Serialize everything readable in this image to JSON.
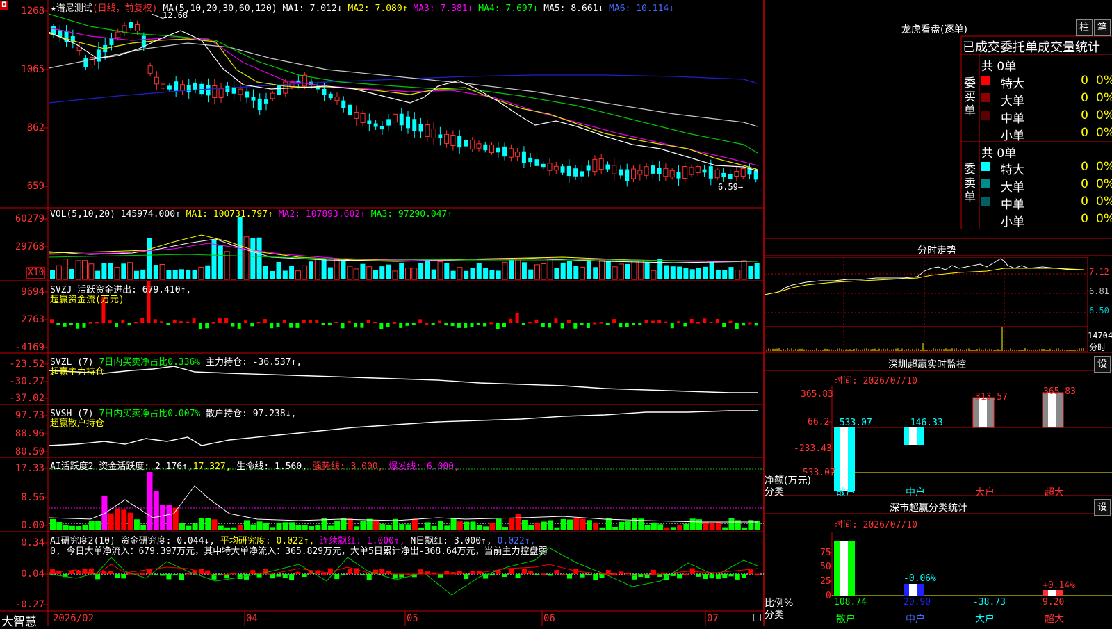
{
  "main_chart": {
    "logo": "◘",
    "stock_name": "★谱尼测试",
    "period": "(日线，前复权)",
    "ma_label": "MA(5,10,20,30,60,120)",
    "ma1": "MA1: 7.012↓",
    "ma2": "MA2: 7.080↑",
    "ma3": "MA3: 7.381↓",
    "ma4": "MA4: 7.697↓",
    "ma5": "MA5: 8.661↓",
    "ma6": "MA6: 10.114↓",
    "high_marker": "12.68",
    "low_marker": "6.59→",
    "axis": [
      "1268",
      "1065",
      "862",
      "659"
    ]
  },
  "vol_pane": {
    "label": "VOL(5,10,20)",
    "value": "145974.000↑",
    "ma1": "MA1: 100731.797↑",
    "ma2": "MA2: 107893.602↑",
    "ma3": "MA3: 97290.047↑",
    "axis": [
      "60279",
      "29768"
    ],
    "unit": "X10"
  },
  "svzj_pane": {
    "label": "SVZJ",
    "text": "活跃资金进出: 679.410↑,",
    "subtitle": "超赢资金流(万元)",
    "axis": [
      "9694",
      "2763",
      "-4169"
    ]
  },
  "svzl_pane": {
    "label": "SVZL (7)",
    "text_green": "7日内买卖净占比0.336%",
    "text_white": "主力持仓: -36.537↑,",
    "subtitle": "超赢主力持仓",
    "axis": [
      "-23.52",
      "-30.27",
      "-37.02"
    ]
  },
  "svsh_pane": {
    "label": "SVSH (7)",
    "text_green": "7日内买卖净占比0.007%",
    "text_white": "散户持仓: 97.238↓,",
    "subtitle": "超赢散户持仓",
    "axis": [
      "97.73",
      "88.96",
      "80.50"
    ]
  },
  "ai_act_pane": {
    "label": "AI活跃度2",
    "t1": "资金活跃度: 2.176↑,",
    "t2": "17.327,",
    "t3": "生命线: 1.560,",
    "t4": "强势线: 3.000,",
    "t5": "爆发线: 6.000,",
    "axis": [
      "17.33",
      "8.56",
      "0.00"
    ]
  },
  "ai_res_pane": {
    "label": "AI研究度2(10)",
    "t1": "资金研究度: 0.044↓,",
    "t2": "平均研究度: 0.022↑,",
    "t3": "连续飘红: 1.000↑,",
    "t4": "N日飘红: 3.000↑,",
    "t5": "0.022↑,",
    "desc": "0, 今日大单净流入：679.397万元，其中特大单净流入：365.829万元，大单5日累计净出-368.64万元，当前主力控盘弱",
    "axis": [
      "0.34",
      "0.04",
      "-0.27"
    ]
  },
  "footer": {
    "brand": "大智慧",
    "dates": [
      "2026/02",
      "04",
      "05",
      "06",
      "07"
    ]
  },
  "right_panel": {
    "dragon_title": "龙虎看盘(逐单)",
    "btn_bar": "柱",
    "btn_pen": "笔",
    "tab_title": "已成交委托单成交量统计",
    "buy_side": "委买单",
    "sell_side": "委卖单",
    "buy_total": "共 0单",
    "sell_total": "共 0单",
    "buy_rows": [
      {
        "name": "特大",
        "v1": "0",
        "v2": "0%",
        "color": "#ff0000"
      },
      {
        "name": "大单",
        "v1": "0",
        "v2": "0%",
        "color": "#8b0000"
      },
      {
        "name": "中单",
        "v1": "0",
        "v2": "0%",
        "color": "#5a0000"
      },
      {
        "name": "小单",
        "v1": "0",
        "v2": "0%",
        "color": "#000000"
      }
    ],
    "sell_rows": [
      {
        "name": "特大",
        "v1": "0",
        "v2": "0%",
        "color": "#00ffff"
      },
      {
        "name": "大单",
        "v1": "0",
        "v2": "0%",
        "color": "#008b8b"
      },
      {
        "name": "中单",
        "v1": "0",
        "v2": "0%",
        "color": "#006060"
      },
      {
        "name": "小单",
        "v1": "0",
        "v2": "0%",
        "color": "#000000"
      }
    ],
    "intraday_title": "分时走势",
    "intraday_axis": [
      "7.12",
      "6.81",
      "6.50",
      "14704",
      "分时"
    ],
    "monitor_title": "深圳超赢实时监控",
    "monitor_set": "设",
    "monitor_time": "时间: 2026/07/10",
    "monitor_axis": [
      "365.83",
      "66.2",
      "-233.43",
      "-533.07"
    ],
    "monitor_ylabel1": "净额(万元)",
    "monitor_ylabel2": "分类",
    "monitor_vals": [
      "-533.07",
      "-146.33",
      "313.57",
      "365.83"
    ],
    "monitor_cats": [
      "散户",
      "中户",
      "大户",
      "超大"
    ],
    "stat_title": "深市超赢分类统计",
    "stat_set": "设",
    "stat_time": "时间: 2026/07/10",
    "stat_axis": [
      "75",
      "50",
      "25",
      "0"
    ],
    "stat_ylabel1": "比例%",
    "stat_ylabel2": "分类",
    "stat_bar_labels": [
      "-0.06%",
      "+0.14%"
    ],
    "stat_vals": [
      "108.74",
      "20.90",
      "-38.73",
      "9.20"
    ],
    "stat_cats": [
      "散户",
      "中户",
      "大户",
      "超大"
    ]
  },
  "chart_data": [
    {
      "type": "bar",
      "title": "深圳超赢实时监控",
      "categories": [
        "散户",
        "中户",
        "大户",
        "超大"
      ],
      "values": [
        -533.07,
        -146.33,
        313.57,
        365.83
      ],
      "ylabel": "净额(万元)",
      "ylim": [
        -533.07,
        365.83
      ]
    },
    {
      "type": "bar",
      "title": "深市超赢分类统计",
      "categories": [
        "散户",
        "中户",
        "大户",
        "超大"
      ],
      "values": [
        108.74,
        20.9,
        -38.73,
        9.2
      ],
      "ylabel": "比例%"
    }
  ]
}
